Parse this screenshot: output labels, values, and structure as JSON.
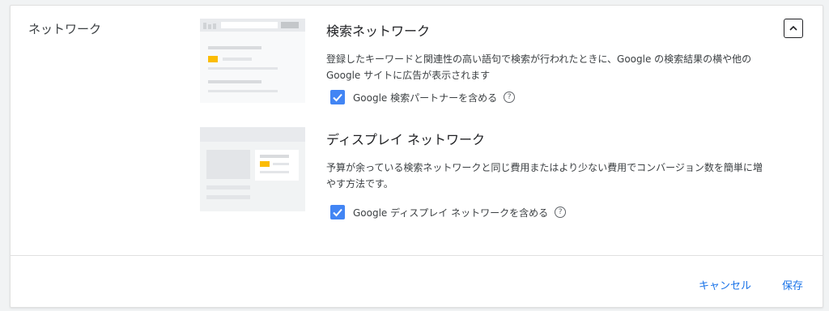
{
  "section": {
    "title": "ネットワーク"
  },
  "search_network": {
    "title": "検索ネットワーク",
    "description": "登録したキーワードと関連性の高い語句で検索が行われたときに、Google の検索結果の横や他の Google サイトに広告が表示されます",
    "checkbox_label": "Google 検索パートナーを含める",
    "checked": true,
    "help_icon": "?"
  },
  "display_network": {
    "title": "ディスプレイ ネットワーク",
    "description": "予算が余っている検索ネットワークと同じ費用またはより少ない費用でコンバージョン数を簡単に増やす方法です。",
    "checkbox_label": "Google ディスプレイ ネットワークを含める",
    "checked": true,
    "help_icon": "?"
  },
  "footer": {
    "cancel_label": "キャンセル",
    "save_label": "保存"
  },
  "colors": {
    "accent": "#1a73e8",
    "checkbox": "#4285f4",
    "ad_highlight": "#fbbc04"
  },
  "icons": {
    "collapse": "chevron-up-icon",
    "help": "help-circle-icon",
    "check": "check-icon"
  }
}
